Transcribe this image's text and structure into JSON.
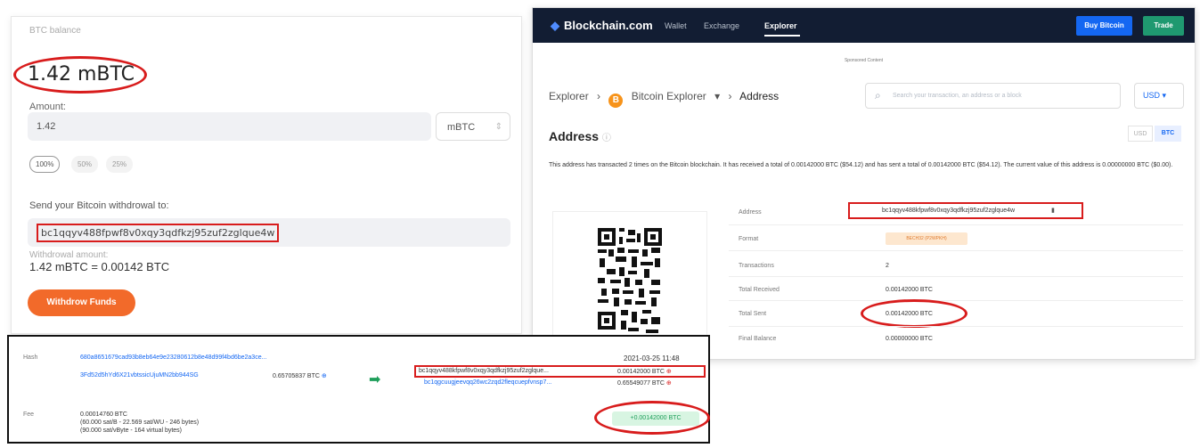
{
  "withdraw": {
    "balance_label": "BTC balance",
    "balance_value": "1.42 mBTC",
    "amount_label": "Amount:",
    "amount_value": "1.42",
    "unit": "mBTC",
    "percent_options": [
      "100%",
      "50%",
      "25%"
    ],
    "send_label": "Send your Bitcoin withdrowal to:",
    "address": "bc1qqyv488fpwf8v0xqy3qdfkzj95zuf2zglque4w",
    "withdrawal_amount_label": "Withdrowal amount:",
    "withdrawal_amount_value": "1.42 mBTC = 0.00142 BTC",
    "button_label": "Withdrow Funds"
  },
  "explorer": {
    "brand": "Blockchain.com",
    "nav": [
      "Wallet",
      "Exchange",
      "Explorer"
    ],
    "buy_label": "Buy Bitcoin",
    "trade_label": "Trade",
    "sponsored": "Sponsored Content",
    "breadcrumb": [
      "Explorer",
      "Bitcoin Explorer",
      "Address"
    ],
    "search_placeholder": "Search your transaction, an address or a block",
    "currency": "USD",
    "page_title": "Address",
    "toggle": [
      "USD",
      "BTC"
    ],
    "description": "This address has transacted 2 times on the Bitcoin blockchain. It has received a total of 0.00142000 BTC ($54.12) and has sent a total of 0.00142000 BTC ($54.12). The current value of this address is 0.00000000 BTC ($0.00).",
    "details": {
      "address_label": "Address",
      "address_value": "bc1qqyv488kfpwf8v0xqy3qdfkzj95zuf2zglque4w",
      "format_label": "Format",
      "format_value": "BECH32 (P2WPKH)",
      "transactions_label": "Transactions",
      "transactions_value": "2",
      "received_label": "Total Received",
      "received_value": "0.00142000 BTC",
      "sent_label": "Total Sent",
      "sent_value": "0.00142000 BTC",
      "balance_label": "Final Balance",
      "balance_value": "0.00000000 BTC"
    }
  },
  "transaction": {
    "hash_label": "Hash",
    "hash_value": "680a8651679cad93b8eb64e9e23280612b8e48d99f4bd6be2a3ce...",
    "date": "2021-03-25 11:48",
    "input_address": "3Fd52d5hYd6X21vbtssicUjuMN2bb944SG",
    "input_amount": "0.65705837 BTC",
    "output1_address": "bc1qqyv488kfpwf8v0xqy3qdfkzj95zuf2zglque...",
    "output1_amount": "0.00142000 BTC",
    "output2_address": "bc1qgcuugjeevqq26wc2zqd2fleqcuepfvnsp7...",
    "output2_amount": "0.65549077 BTC",
    "fee_label": "Fee",
    "fee_value": "0.00014760 BTC",
    "fee_rate1": "(60.000 sat/B - 22.569 sat/WU - 246 bytes)",
    "fee_rate2": "(90.000 sat/vByte - 164 virtual bytes)",
    "net_amount": "+0.00142000 BTC"
  },
  "colors": {
    "accent_orange": "#f26a2a",
    "highlight_red": "#d81c1c",
    "nav_dark": "#121d33",
    "link_blue": "#1467f2",
    "success_green": "#1e9e5a"
  }
}
